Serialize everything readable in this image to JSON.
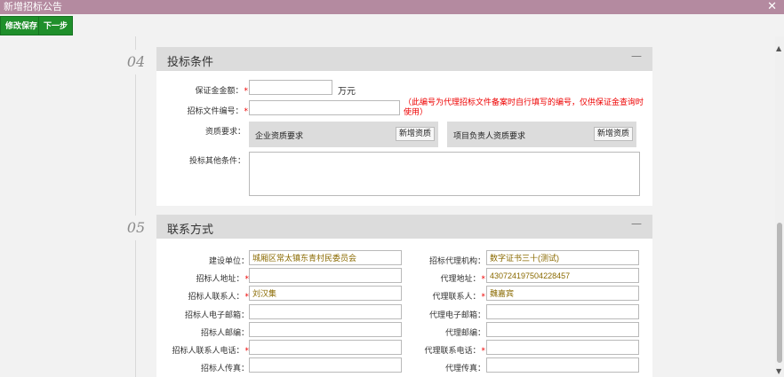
{
  "window": {
    "title": "新增招标公告",
    "close_icon": "close-icon"
  },
  "toolbar": {
    "save_label": "修改保存",
    "next_label": "下一步"
  },
  "section4": {
    "number": "04",
    "title": "投标条件",
    "collapse": "—",
    "deposit_label": "保证金金额：",
    "deposit_value": "",
    "deposit_unit": "万元",
    "file_no_label": "招标文件编号：",
    "file_no_value": "",
    "file_no_note": "（此编号为代理招标文件备案时自行填写的编号，仅供保证金查询时使用）",
    "qual_label": "资质要求：",
    "company_qual_label": "企业资质要求",
    "company_qual_btn": "新增资质",
    "pm_qual_label": "项目负责人资质要求",
    "pm_qual_btn": "新增资质",
    "other_label": "投标其他条件：",
    "other_value": ""
  },
  "section5": {
    "number": "05",
    "title": "联系方式",
    "collapse": "—",
    "left": [
      {
        "label": "建设单位：",
        "required": false,
        "value": "城厢区常太镇东青村民委员会"
      },
      {
        "label": "招标人地址：",
        "required": true,
        "value": ""
      },
      {
        "label": "招标人联系人：",
        "required": true,
        "value": "刘汉集"
      },
      {
        "label": "招标人电子邮箱：",
        "required": false,
        "value": ""
      },
      {
        "label": "招标人邮编：",
        "required": false,
        "value": ""
      },
      {
        "label": "招标人联系人电话：",
        "required": true,
        "value": ""
      },
      {
        "label": "招标人传真：",
        "required": false,
        "value": ""
      }
    ],
    "right": [
      {
        "label": "招标代理机构：",
        "required": false,
        "value": "数字证书三十(测试)"
      },
      {
        "label": "代理地址：",
        "required": true,
        "value": "430724197504228457"
      },
      {
        "label": "代理联系人：",
        "required": true,
        "value": "魏嘉宾"
      },
      {
        "label": "代理电子邮箱：",
        "required": false,
        "value": ""
      },
      {
        "label": "代理邮编：",
        "required": false,
        "value": ""
      },
      {
        "label": "代理联系电话：",
        "required": true,
        "value": ""
      },
      {
        "label": "代理传真：",
        "required": false,
        "value": ""
      }
    ],
    "required_mark": "*"
  }
}
